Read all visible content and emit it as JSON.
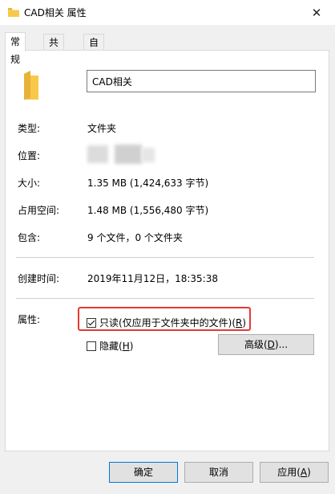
{
  "window": {
    "title": "CAD相关 属性",
    "close_glyph": "✕"
  },
  "tabs": [
    "常规",
    "共享",
    "自定义"
  ],
  "general": {
    "name_value": "CAD相关",
    "type_label": "类型:",
    "type_value": "文件夹",
    "location_label": "位置:",
    "size_label": "大小:",
    "size_value": "1.35 MB (1,424,633 字节)",
    "disk_label": "占用空间:",
    "disk_value": "1.48 MB (1,556,480 字节)",
    "contains_label": "包含:",
    "contains_value": "9 个文件，0 个文件夹",
    "created_label": "创建时间:",
    "created_value": "2019年11月12日，18:35:38",
    "attributes_label": "属性:",
    "readonly": {
      "text": "只读(仅应用于文件夹中的文件)(",
      "key": "R",
      "close": ")",
      "checked": true
    },
    "hidden": {
      "text": "隐藏(",
      "key": "H",
      "close": ")",
      "checked": false
    },
    "advanced": {
      "text": "高级(",
      "key": "D",
      "close": ")..."
    }
  },
  "buttons": {
    "ok": "确定",
    "cancel": "取消",
    "apply_text": "应用(",
    "apply_key": "A",
    "apply_close": ")"
  },
  "colors": {
    "highlight": "#e53935",
    "folder": "#f8c84a",
    "accent": "#0078d7"
  },
  "icons": [
    "folder-icon",
    "close-icon",
    "checkbox-checked-icon"
  ]
}
